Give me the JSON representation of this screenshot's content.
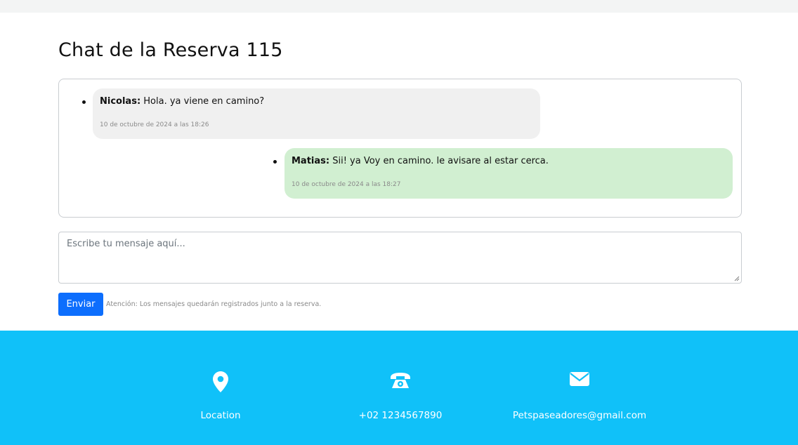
{
  "page": {
    "title": "Chat de la Reserva 115"
  },
  "chat": {
    "messages": [
      {
        "author": "Nicolas:",
        "text": " Hola. ya viene en camino?",
        "time": "10 de octubre de 2024 a las 18:26",
        "side": "left"
      },
      {
        "author": "Matias:",
        "text": " Sii! ya Voy en camino. le avisare al estar cerca.",
        "time": "10 de octubre de 2024 a las 18:27",
        "side": "right"
      }
    ]
  },
  "composer": {
    "placeholder": "Escribe tu mensaje aquí...",
    "send_label": "Enviar",
    "notice": "Atención: Los mensajes quedarán registrados junto a la reserva."
  },
  "footer": {
    "items": [
      {
        "icon": "location-pin-icon",
        "label": "Location"
      },
      {
        "icon": "phone-icon",
        "label": "+02 1234567890"
      },
      {
        "icon": "envelope-icon",
        "label": "Petspaseadores@gmail.com"
      }
    ]
  },
  "colors": {
    "footer_bg": "#10c1f9",
    "send_button": "#0d6efd",
    "left_bubble": "#f0f0f0",
    "right_bubble": "#d1efd1"
  }
}
